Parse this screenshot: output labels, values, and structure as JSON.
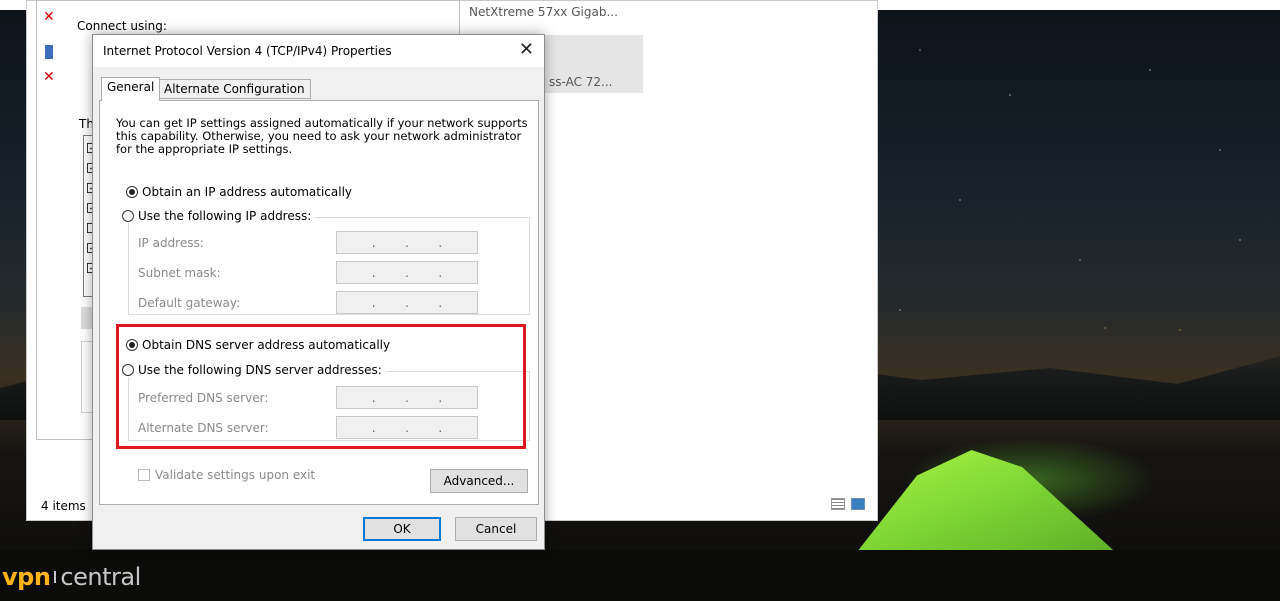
{
  "background_window": {
    "status_text": "4 items",
    "adapter_line1": "NetXtreme 57xx Gigab...",
    "adapter_line2": "ss-AC 72..."
  },
  "adapter_properties": {
    "connect_using_label": "Connect using:",
    "components_label": "Th"
  },
  "dialog": {
    "title": "Internet Protocol Version 4 (TCP/IPv4) Properties",
    "close_symbol": "✕",
    "tabs": [
      {
        "label": "General",
        "active": true
      },
      {
        "label": "Alternate Configuration",
        "active": false
      }
    ],
    "intro_text": "You can get IP settings assigned automatically if your network supports this capability. Otherwise, you need to ask your network administrator for the appropriate IP settings.",
    "ip": {
      "auto_label": "Obtain an IP address automatically",
      "manual_label": "Use the following IP address:",
      "selected": "auto",
      "fields": [
        {
          "label": "IP address:",
          "value": ".   .   ."
        },
        {
          "label": "Subnet mask:",
          "value": ".   .   ."
        },
        {
          "label": "Default gateway:",
          "value": ".   .   ."
        }
      ]
    },
    "dns": {
      "auto_label": "Obtain DNS server address automatically",
      "manual_label": "Use the following DNS server addresses:",
      "selected": "auto",
      "fields": [
        {
          "label": "Preferred DNS server:",
          "value": ".   .   ."
        },
        {
          "label": "Alternate DNS server:",
          "value": ".   .   ."
        }
      ]
    },
    "validate_label": "Validate settings upon exit",
    "validate_checked": false,
    "advanced_button": "Advanced...",
    "ok_button": "OK",
    "cancel_button": "Cancel"
  },
  "highlight_color": "#e0171c",
  "brand": {
    "part1": "vpn",
    "part2": "central"
  }
}
